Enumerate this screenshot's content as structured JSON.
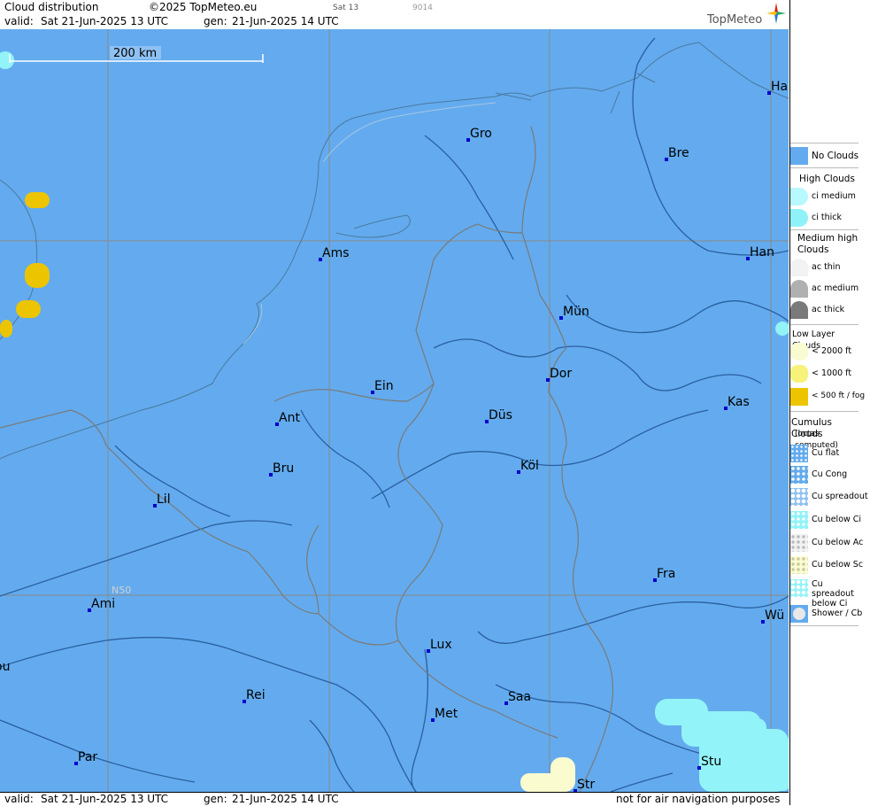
{
  "header": {
    "title": "Cloud distribution",
    "copyright": "©2025 TopMeteo.eu",
    "product": "Sat 13",
    "code": "9014",
    "valid_label": "valid:",
    "valid_value": "Sat  21-Jun-2025  13 UTC",
    "gen_label": "gen:",
    "gen_value": "21-Jun-2025 14 UTC",
    "brand": "TopMeteo"
  },
  "map": {
    "scale_label": "200 km",
    "grid_label": "N50",
    "cities": [
      {
        "label": "Gro"
      },
      {
        "label": "Bre"
      },
      {
        "label": "Ha"
      },
      {
        "label": "Ams"
      },
      {
        "label": "Han"
      },
      {
        "label": "Mün"
      },
      {
        "label": "Dor"
      },
      {
        "label": "Ein"
      },
      {
        "label": "Ant"
      },
      {
        "label": "Düs"
      },
      {
        "label": "Kas"
      },
      {
        "label": "Köl"
      },
      {
        "label": "Bru"
      },
      {
        "label": "Lil"
      },
      {
        "label": "Fra"
      },
      {
        "label": "Ami"
      },
      {
        "label": "Wü"
      },
      {
        "label": "Lux"
      },
      {
        "label": "ou"
      },
      {
        "label": "Rei"
      },
      {
        "label": "Saa"
      },
      {
        "label": "Met"
      },
      {
        "label": "Par"
      },
      {
        "label": "Stu"
      },
      {
        "label": "Str"
      }
    ]
  },
  "footer": {
    "valid_label": "valid:",
    "valid_value": "Sat  21-Jun-2025  13 UTC",
    "gen_label": "gen:",
    "gen_value": "21-Jun-2025 14 UTC",
    "disclaimer": "not for air navigation purposes"
  },
  "legend": {
    "no_clouds": "No Clouds",
    "high_head": "High Clouds",
    "ci_medium": "ci medium",
    "ci_thick": "ci thick",
    "medium_head": "Medium high Clouds",
    "ac_thin": "ac thin",
    "ac_medium": "ac medium",
    "ac_thick": "ac thick",
    "low_head": "Low Layer Clouds",
    "low_2000": "< 2000 ft",
    "low_1000": "< 1000 ft",
    "low_500": "< 500 ft / fog",
    "cu_head": "Cumulus Clouds",
    "cu_sub": "(octas computed)",
    "cu_flat": "Cu flat",
    "cu_cong": "Cu Cong",
    "cu_spreadout": "Cu spreadout",
    "cu_below_ci": "Cu below Ci",
    "cu_below_ac": "Cu below Ac",
    "cu_below_sc": "Cu below Sc",
    "cu_spread_ci": "Cu spreadout below Ci",
    "shower": "Shower / Cb",
    "colors": {
      "no_clouds": "#63abee",
      "ci_medium": "#b8f8ff",
      "ci_thick": "#8ef2f8",
      "ac_thin": "#f2f2f2",
      "ac_medium": "#b0b0b0",
      "ac_thick": "#7a7a7a",
      "low_2000": "#fbfbd2",
      "low_1000": "#f7f37a",
      "low_500": "#edc400"
    }
  }
}
